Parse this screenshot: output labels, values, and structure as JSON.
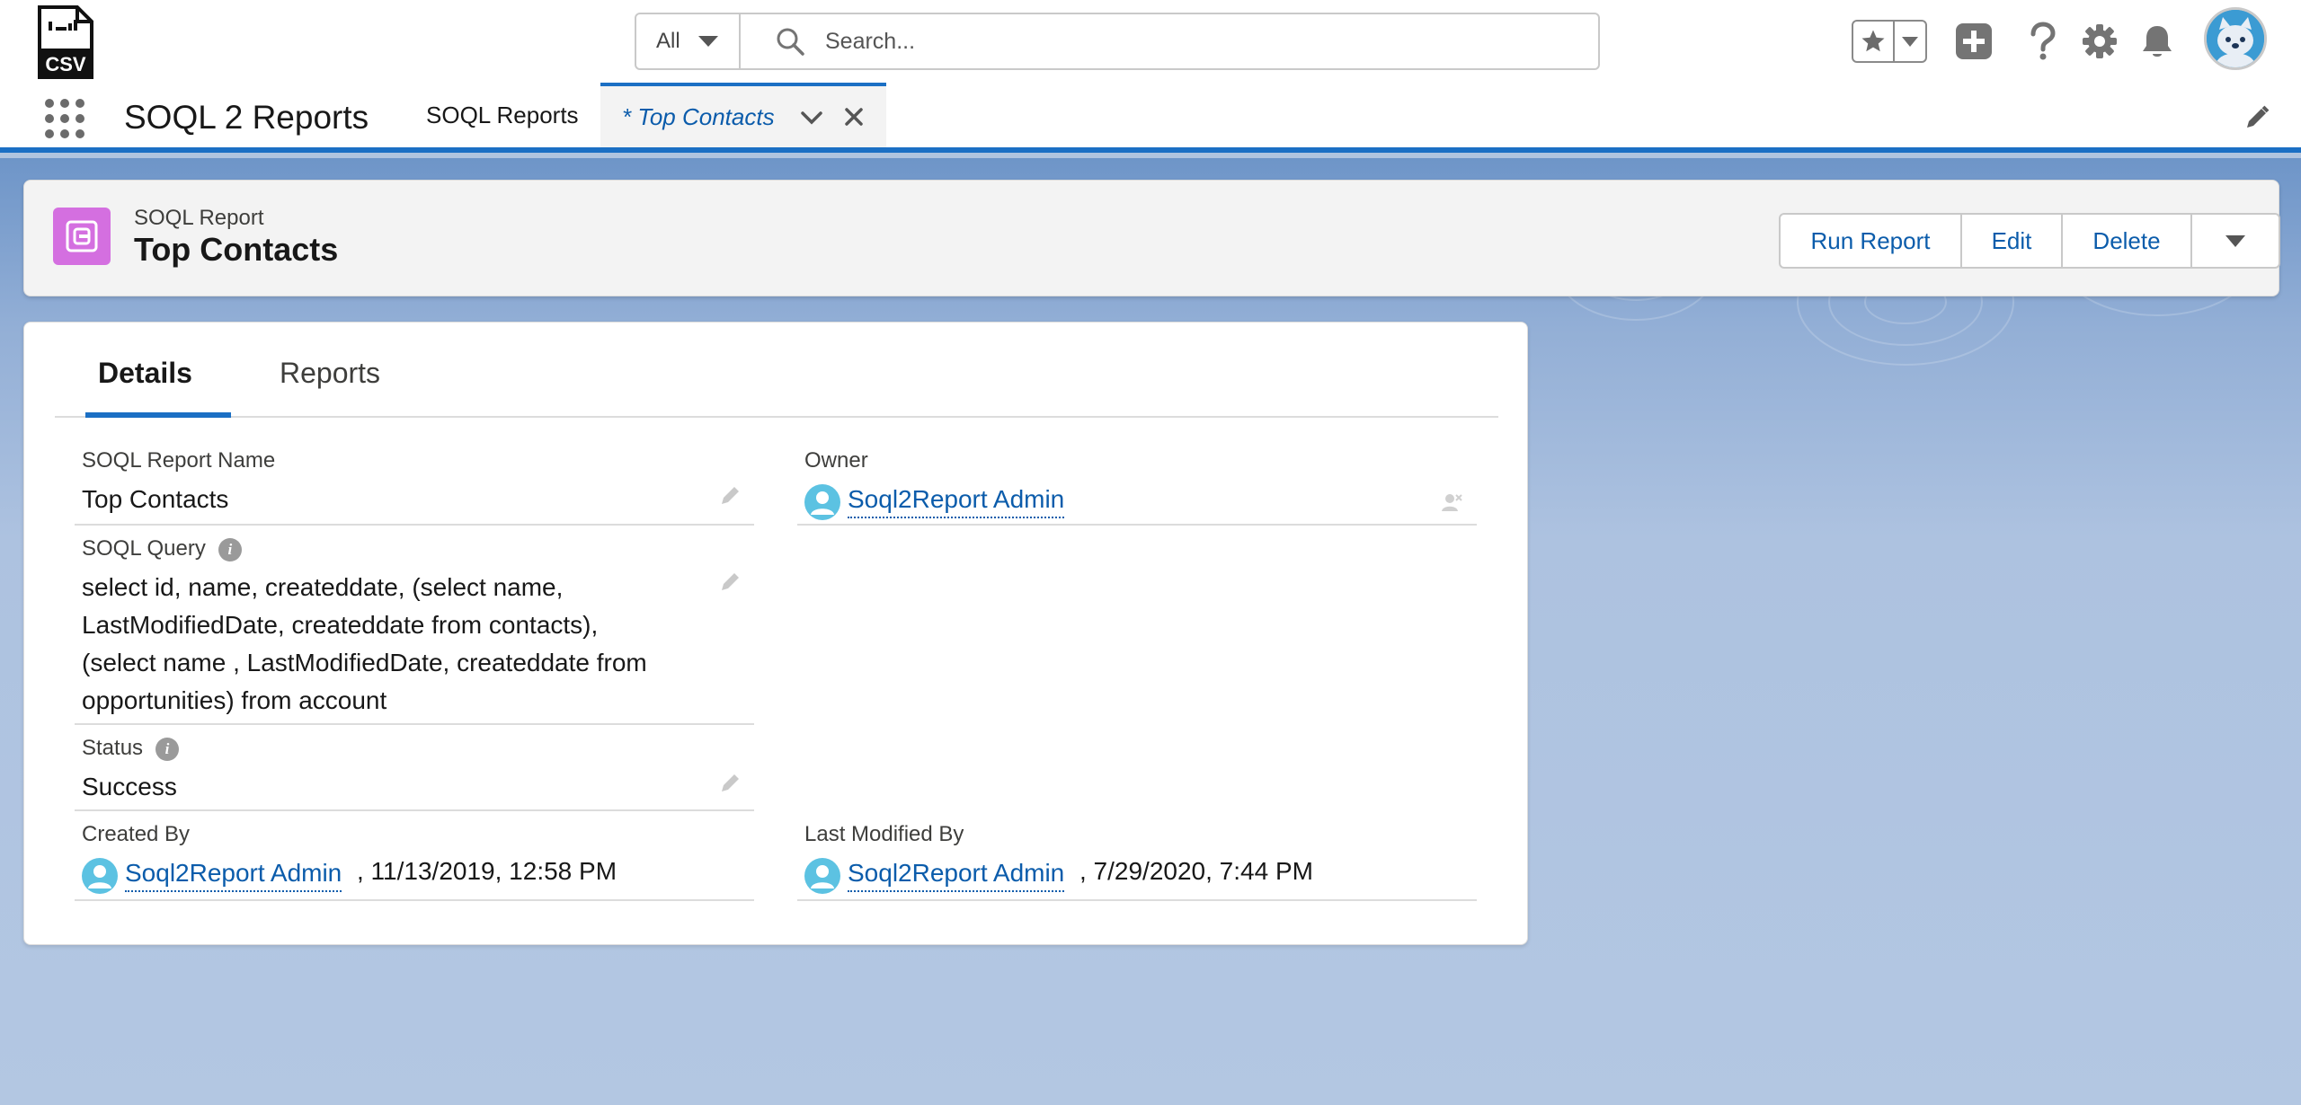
{
  "header": {
    "logo_text": "CSV",
    "search": {
      "scope": "All",
      "placeholder": "Search..."
    }
  },
  "nav": {
    "app_name": "SOQL 2 Reports",
    "tabs": [
      {
        "label": "SOQL Reports"
      },
      {
        "label": "* Top Contacts"
      }
    ]
  },
  "record": {
    "type": "SOQL Report",
    "title": "Top Contacts",
    "actions": {
      "run": "Run Report",
      "edit": "Edit",
      "delete": "Delete"
    }
  },
  "detail_tabs": {
    "details": "Details",
    "reports": "Reports"
  },
  "fields": {
    "name": {
      "label": "SOQL Report Name",
      "value": "Top Contacts"
    },
    "owner": {
      "label": "Owner",
      "value": "Soql2Report Admin"
    },
    "query": {
      "label": "SOQL Query",
      "lines": [
        "select id, name, createddate, (select name,",
        "LastModifiedDate, createddate from contacts),",
        "(select name , LastModifiedDate, createddate from",
        "opportunities) from account"
      ]
    },
    "status": {
      "label": "Status",
      "value": "Success"
    },
    "created_by": {
      "label": "Created By",
      "user": "Soql2Report Admin",
      "timestamp": ", 11/13/2019, 12:58 PM"
    },
    "modified_by": {
      "label": "Last Modified By",
      "user": "Soql2Report Admin",
      "timestamp": ", 7/29/2020, 7:44 PM"
    }
  },
  "colors": {
    "brand": "#1b6fc4",
    "link": "#0b5cab",
    "record_icon": "#d46fe0",
    "avatar": "#5cc2e2"
  },
  "icons": {
    "search": "search-icon",
    "favorites": "star-icon",
    "add": "plus-icon",
    "help": "question-icon",
    "setup": "gear-icon",
    "notifications": "bell-icon",
    "edit": "pencil-icon"
  }
}
